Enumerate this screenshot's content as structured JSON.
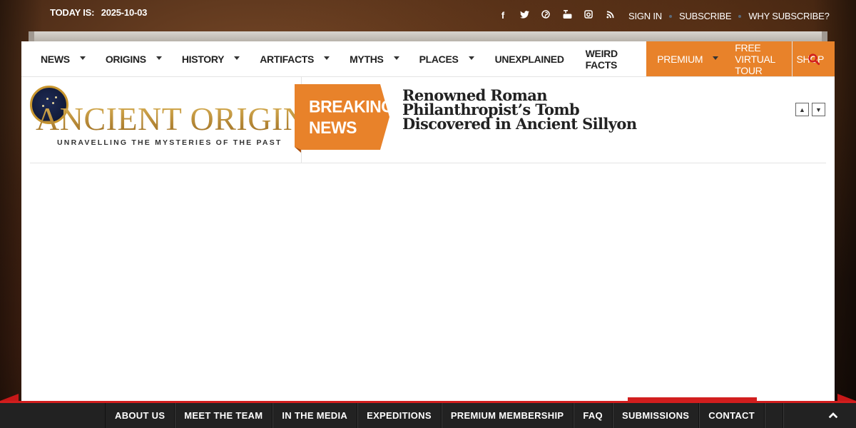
{
  "topbar": {
    "date_label": "TODAY IS:",
    "date_value": "2025-10-03",
    "social_icons": [
      "facebook-icon",
      "twitter-icon",
      "pinterest-icon",
      "youtube-icon",
      "instagram-icon",
      "rss-icon"
    ],
    "links": {
      "sign_in": "SIGN IN",
      "subscribe": "SUBSCRIBE",
      "why_subscribe": "WHY SUBSCRIBE?"
    }
  },
  "nav": {
    "items": [
      "NEWS",
      "ORIGINS",
      "HISTORY",
      "ARTIFACTS",
      "MYTHS",
      "PLACES"
    ],
    "unexplained": "UNEXPLAINED",
    "weird_facts": "WEIRD FACTS",
    "premium": "PREMIUM",
    "free_tour": "FREE VIRTUAL TOUR",
    "shop": "SHOP"
  },
  "logo": {
    "name": "ANCIENT ORIGINS",
    "tagline": "UNRAVELLING THE MYSTERIES OF THE PAST"
  },
  "breaking": {
    "label_line1": "BREAKING",
    "label_line2": "NEWS",
    "headline": "Renowned Roman Philanthropist’s Tomb Discovered in Ancient Sillyon"
  },
  "footer": {
    "items": [
      "ABOUT US",
      "MEET THE TEAM",
      "IN THE MEDIA",
      "EXPEDITIONS",
      "PREMIUM MEMBERSHIP",
      "FAQ",
      "SUBMISSIONS",
      "CONTACT"
    ]
  },
  "colors": {
    "accent_orange": "#e8822a",
    "footer_bg": "#222222",
    "footer_red": "#d21e1e",
    "search_red": "#d21e1e"
  }
}
